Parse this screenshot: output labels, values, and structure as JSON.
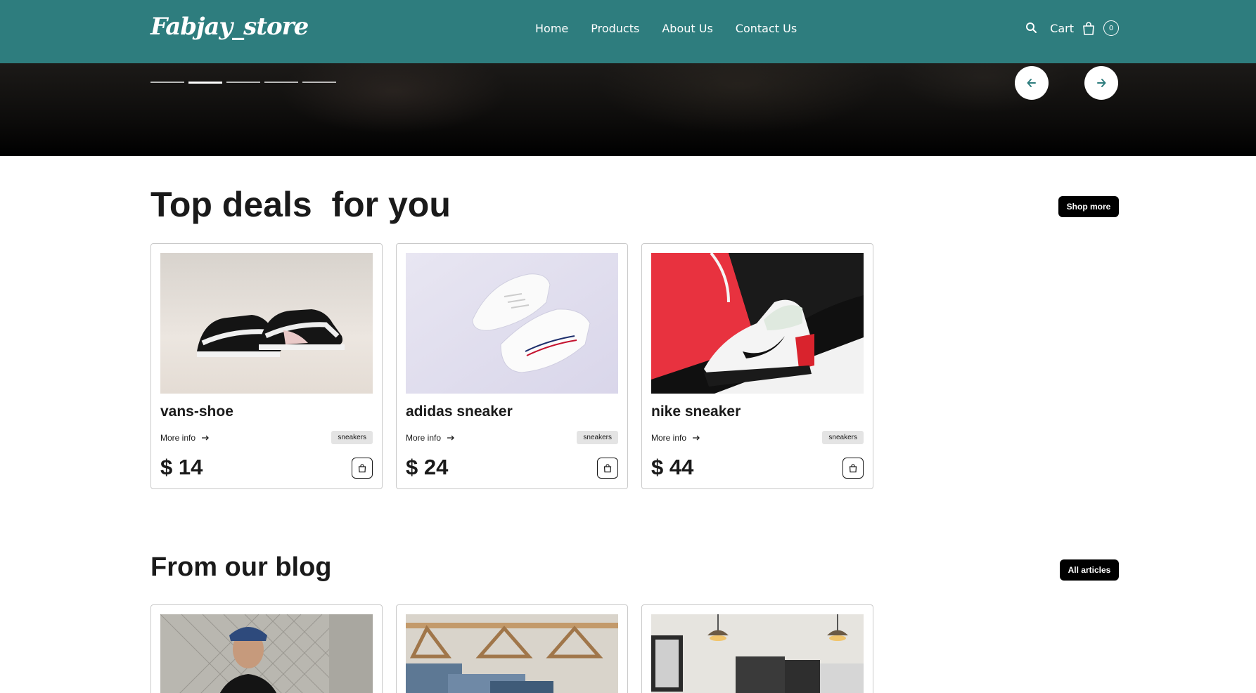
{
  "brand": {
    "logo": "Fabjay_store"
  },
  "nav": {
    "items": [
      "Home",
      "Products",
      "About Us",
      "Contact Us"
    ]
  },
  "cart": {
    "label": "Cart",
    "count": "0"
  },
  "icons": {
    "search": "search-icon",
    "bag": "shopping-bag-icon",
    "prev": "arrow-left-icon",
    "next": "arrow-right-icon",
    "more": "arrow-right-icon"
  },
  "colors": {
    "header_bg": "#2e7d7e",
    "accent": "#2e7d7e",
    "button_bg": "#000000"
  },
  "hero": {
    "slides_total": 5,
    "active_slide": 2
  },
  "deals": {
    "title": "Top deals  for you",
    "shop_more_label": "Shop more",
    "products": [
      {
        "name": "vans-shoe",
        "more_label": "More info",
        "tag": "sneakers",
        "price": "$ 14"
      },
      {
        "name": "adidas sneaker",
        "more_label": "More info",
        "tag": "sneakers",
        "price": "$ 24"
      },
      {
        "name": "nike sneaker",
        "more_label": "More info",
        "tag": "sneakers",
        "price": "$ 44"
      }
    ]
  },
  "blog": {
    "title": "From our blog",
    "all_articles_label": "All articles"
  }
}
